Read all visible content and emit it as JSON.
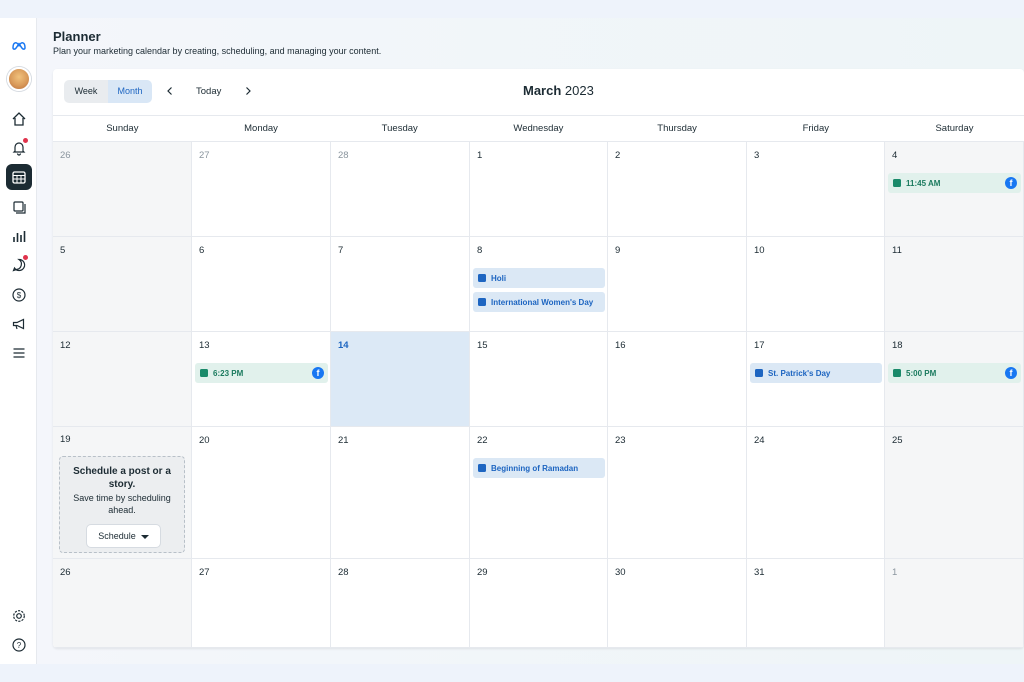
{
  "header": {
    "title": "Planner",
    "subtitle": "Plan your marketing calendar by creating, scheduling, and managing your content."
  },
  "toolbar": {
    "week_label": "Week",
    "month_label": "Month",
    "today_label": "Today",
    "month_name": "March",
    "year": "2023"
  },
  "days_of_week": [
    "Sunday",
    "Monday",
    "Tuesday",
    "Wednesday",
    "Thursday",
    "Friday",
    "Saturday"
  ],
  "weeks": [
    [
      "26",
      "27",
      "28",
      "1",
      "2",
      "3",
      "4"
    ],
    [
      "5",
      "6",
      "7",
      "8",
      "9",
      "10",
      "11"
    ],
    [
      "12",
      "13",
      "14",
      "15",
      "16",
      "17",
      "18"
    ],
    [
      "19",
      "20",
      "21",
      "22",
      "23",
      "24",
      "25"
    ],
    [
      "26",
      "27",
      "28",
      "29",
      "30",
      "31",
      "1"
    ]
  ],
  "events": {
    "sat4_post": "11:45 AM",
    "holi": "Holi",
    "womens_day": "International Women's Day",
    "mon13_post": "6:23 PM",
    "st_patricks": "St. Patrick's Day",
    "sat18_post": "5:00 PM",
    "ramadan": "Beginning of Ramadan"
  },
  "schedule_prompt": {
    "title": "Schedule a post or a story.",
    "subtitle": "Save time by scheduling ahead.",
    "button_label": "Schedule"
  },
  "colors": {
    "accent": "#1d65c1",
    "facebook": "#1877f2",
    "post_green": "#1a7a5e",
    "today_bg": "#dce9f6"
  },
  "icons": {
    "brand": "meta-logo-icon",
    "nav": [
      "home-icon",
      "notifications-icon",
      "planner-icon",
      "content-icon",
      "insights-icon",
      "inbox-icon",
      "monetization-icon",
      "ads-icon",
      "menu-icon"
    ],
    "footer": [
      "settings-icon",
      "help-icon"
    ]
  }
}
